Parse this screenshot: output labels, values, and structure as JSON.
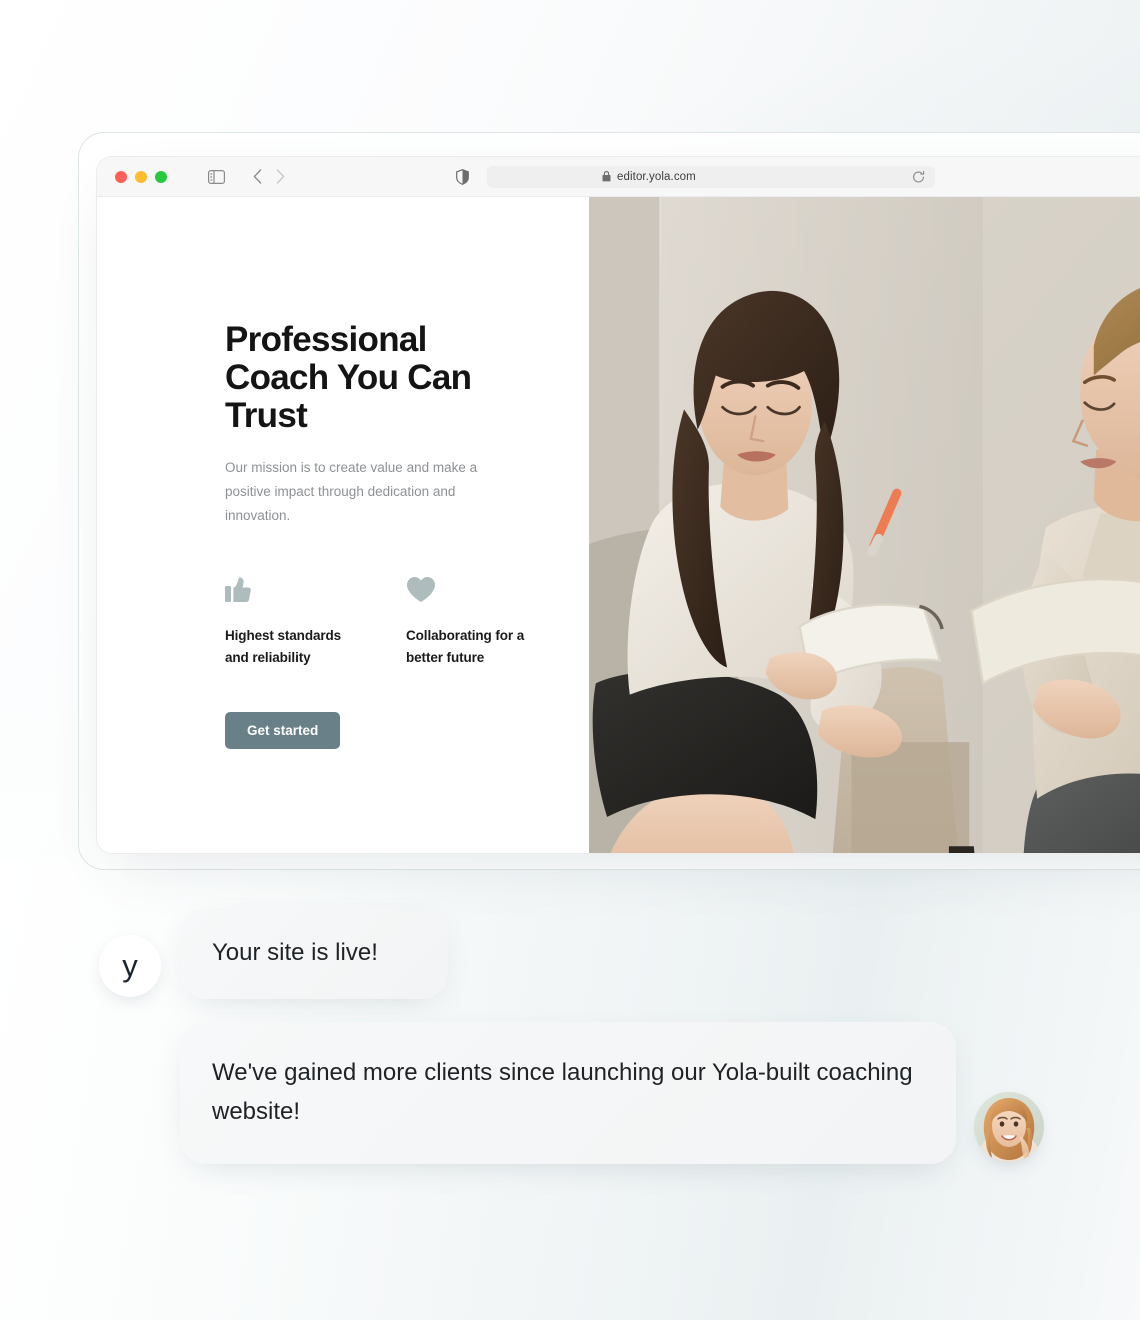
{
  "browser": {
    "url": "editor.yola.com",
    "icons": {
      "sidebar": "sidebar-toggle-icon",
      "back": "back-chevron-icon",
      "forward": "forward-chevron-icon",
      "shield": "shield-icon",
      "lock": "lock-icon",
      "reload": "reload-icon"
    },
    "traffic_lights": {
      "close": "#ff5f57",
      "minimize": "#febc2e",
      "maximize": "#28c840"
    }
  },
  "hero": {
    "title": "Professional Coach You Can Trust",
    "subtitle": "Our mission is to create value and make a positive impact through dedication and innovation.",
    "features": [
      {
        "icon": "thumbs-up-icon",
        "label": "Highest standards and reliability"
      },
      {
        "icon": "heart-icon",
        "label": "Collaborating for a better future"
      }
    ],
    "cta_label": "Get started",
    "cta_color": "#698088",
    "photo_alt": "Two women seated on a sofa during a coaching session, one taking notes"
  },
  "chat": {
    "brand_initial": "y",
    "messages": [
      {
        "text": "Your site is live!"
      },
      {
        "text": "We've gained more clients since launching our Yola-built coaching website!"
      }
    ],
    "client_avatar_alt": "Smiling woman with auburn hair"
  }
}
